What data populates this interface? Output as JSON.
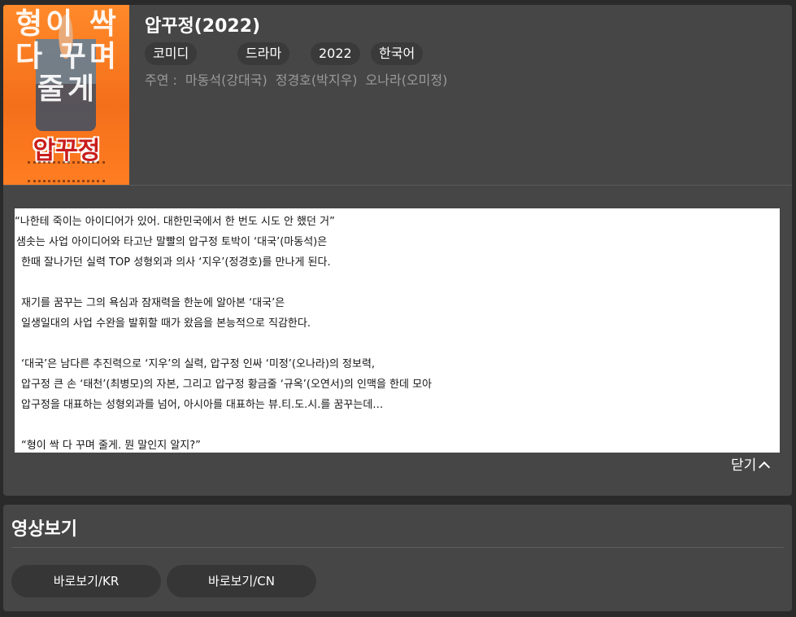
{
  "movie": {
    "title": "압꾸정(2022)",
    "poster_headline": "형이 싹 다 꾸며 줄게",
    "poster_logo": "압꾸정",
    "tags": [
      "코미디",
      "드라마",
      "2022",
      "한국어"
    ],
    "cast_label": "주연 :",
    "cast": [
      "마동석(강대국)",
      "정경호(박지우)",
      "오나라(오미정)"
    ]
  },
  "synopsis": {
    "lines": [
      "“나한테 죽이는 아이디어가 있어. 대한민국에서 한 번도 시도 안 했던 거”",
      "샘솟는 사업 아이디어와 타고난 말빨의 압구정 토박이 ‘대국’(마동석)은",
      "한때 잘나가던 실력 TOP 성형외과 의사 ‘지우’(정경호)를 만나게 된다.",
      "재기를 꿈꾸는 그의 욕심과 잠재력을 한눈에 알아본 ‘대국’은",
      "일생일대의 사업 수완을 발휘할 때가 왔음을 본능적으로 직감한다.",
      "‘대국’은 남다른 추진력으로 ‘지우’의 실력, 압구정 인싸 ‘미정’(오나라)의 정보력,",
      "압구정 큰 손 ‘태천’(최병모)의 자본, 그리고 압구정 황금줄 ‘규옥’(오연서)의 인맥을 한데 모아",
      "압구정을 대표하는 성형외과를 넘어, 아시아를 대표하는 뷰.티.도.시.를 꿈꾸는데…",
      "“형이 싹 다 꾸며 줄게. 뭔 말인지 알지?”"
    ],
    "toggle_label": "닫기"
  },
  "video": {
    "section_title": "영상보기",
    "buttons": [
      "바로보기/KR",
      "바로보기/CN"
    ]
  },
  "colors": {
    "panel_bg": "#464646",
    "page_bg": "#2a2a2a",
    "tag_bg": "#3a3a3a",
    "button_bg": "#363636",
    "poster_orange": "#f46f1a",
    "muted_text": "#9a9a9a"
  },
  "icons": {
    "toggle": "chevron-up-icon"
  }
}
